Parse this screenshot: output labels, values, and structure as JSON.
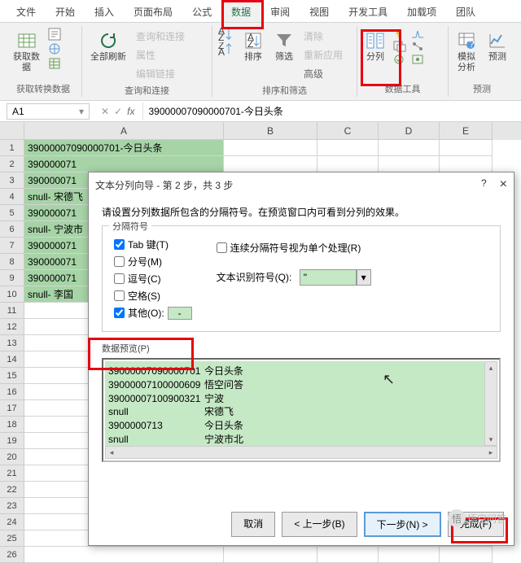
{
  "tabs": {
    "file": "文件",
    "home": "开始",
    "insert": "插入",
    "layout": "页面布局",
    "formula": "公式",
    "data": "数据",
    "review": "审阅",
    "view": "视图",
    "dev": "开发工具",
    "addin": "加载项",
    "team": "团队"
  },
  "ribbon": {
    "getdata": "获取数\n据",
    "g1": "获取转换数据",
    "refresh": "全部刷新",
    "query": "查询和连接",
    "prop": "属性",
    "editlink": "编辑链接",
    "g2": "查询和连接",
    "sort": "排序",
    "filter": "筛选",
    "clear": "清除",
    "reapply": "重新应用",
    "adv": "高级",
    "g3": "排序和筛选",
    "texttocol": "分列",
    "g4": "数据工具",
    "forecast": "模拟分析",
    "predict": "预测",
    "g5": "预测"
  },
  "icons": {
    "side1": "",
    "side2": "",
    "side3": "",
    "side4": ""
  },
  "namebox": "A1",
  "fx": "fx",
  "formula_value": "39000007090000701-今日头条",
  "cols": {
    "A": "A",
    "B": "B",
    "C": "C",
    "D": "D",
    "E": "E"
  },
  "rows": [
    "39000007090000701-今日头条",
    "390000071",
    "390000071",
    "snull- 宋德飞",
    "390000071",
    "snull- 宁波市",
    "390000071",
    "390000071",
    "390000071",
    "snull- 李国"
  ],
  "row_prefix": [
    "3",
    "3",
    "s",
    "3",
    "s",
    "3",
    "3",
    "3",
    "s"
  ],
  "dialog": {
    "title": "文本分列向导 - 第 2 步，共 3 步",
    "help": "?",
    "close": "×",
    "instr": "请设置分列数据所包含的分隔符号。在预览窗口内可看到分列的效果。",
    "delim_legend": "分隔符号",
    "tab": "Tab 键(T)",
    "semi": "分号(M)",
    "comma": "逗号(C)",
    "space": "空格(S)",
    "other": "其他(O):",
    "other_val": "-",
    "consec": "连续分隔符号视为单个处理(R)",
    "textqual": "文本识别符号(Q):",
    "textqual_val": "\"",
    "preview_label": "数据预览(P)",
    "preview": [
      [
        "39000007090000701",
        "今日头条"
      ],
      [
        "39000007100000609",
        "悟空问答"
      ],
      [
        "39000007100900321",
        "宁波"
      ],
      [
        "snull",
        "宋德飞"
      ],
      [
        "3900000713",
        "今日头条"
      ],
      [
        "snull",
        "宁波市北"
      ]
    ],
    "cancel": "取消",
    "back": "< 上一步(B)",
    "next": "下一步(N) >",
    "finish": "完成(F)"
  },
  "watermark": "悟空问答",
  "chart_data": null
}
